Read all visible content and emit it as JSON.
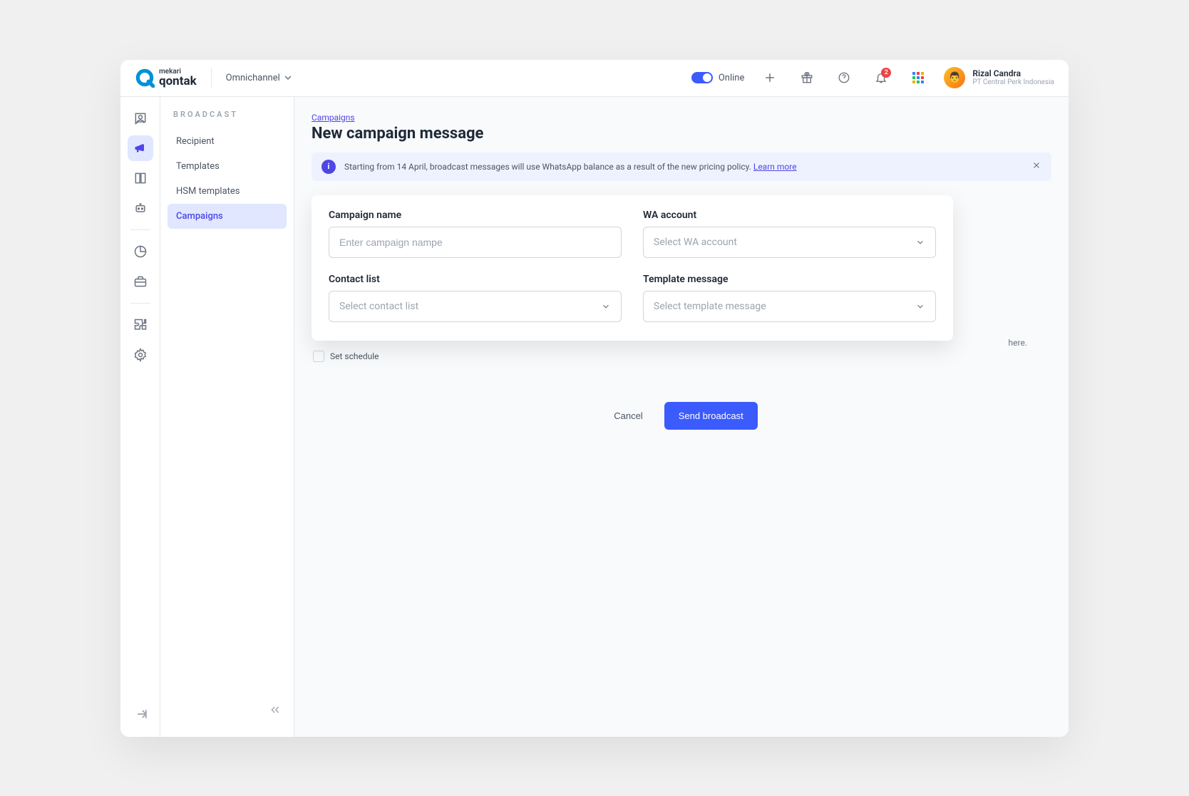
{
  "header": {
    "logo_top": "mekari",
    "logo_bottom": "qontak",
    "workspace": "Omnichannel",
    "online_label": "Online",
    "notification_count": "2",
    "user_name": "Rizal Candra",
    "user_org": "PT Central Perk Indonesia"
  },
  "sidebar": {
    "title": "BROADCAST",
    "items": [
      {
        "label": "Recipient"
      },
      {
        "label": "Templates"
      },
      {
        "label": "HSM templates"
      },
      {
        "label": "Campaigns"
      }
    ]
  },
  "page": {
    "breadcrumb": "Campaigns",
    "title": "New campaign message"
  },
  "alert": {
    "text": "Starting from 14 April, broadcast messages will use WhatsApp balance as a result of the new pricing policy. ",
    "link": "Learn more"
  },
  "form": {
    "campaign_name_label": "Campaign name",
    "campaign_name_placeholder": "Enter campaign nampe",
    "wa_account_label": "WA account",
    "wa_account_placeholder": "Select WA account",
    "contact_list_label": "Contact list",
    "contact_list_placeholder": "Select contact list",
    "template_message_label": "Template message",
    "template_message_placeholder": "Select template message",
    "set_schedule_label": "Set schedule",
    "behind_hint": "here.",
    "cancel": "Cancel",
    "submit": "Send broadcast"
  }
}
